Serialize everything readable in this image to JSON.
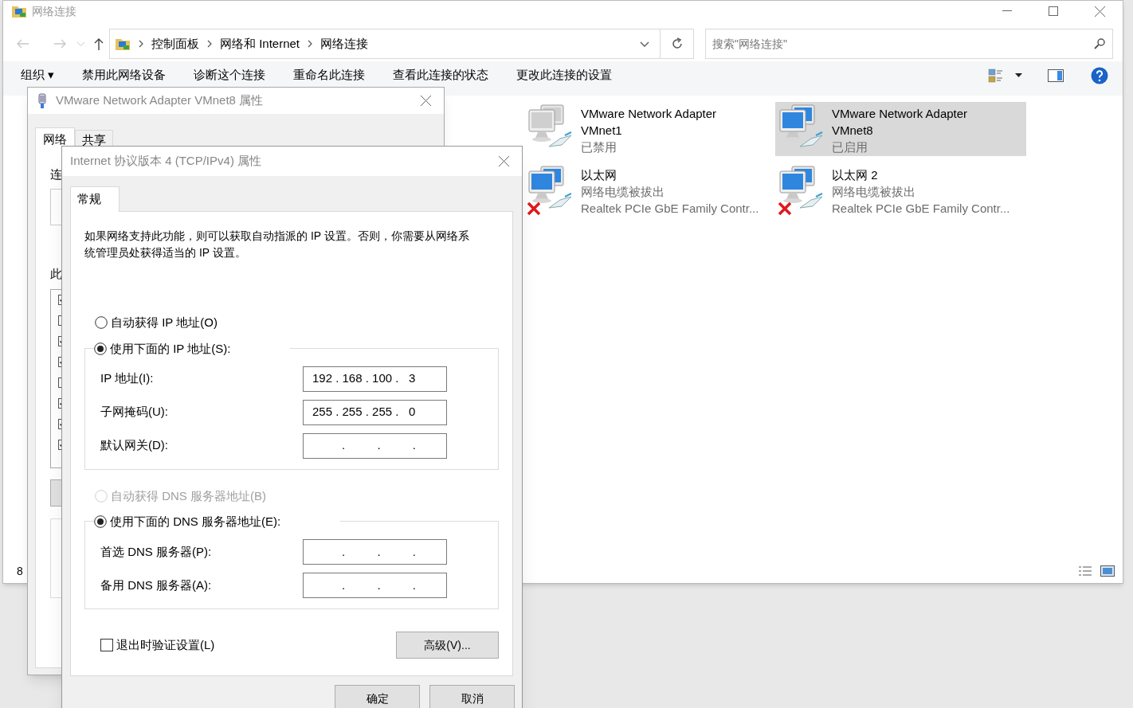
{
  "explorer": {
    "title": "网络连接",
    "breadcrumbs": [
      "控制面板",
      "网络和 Internet",
      "网络连接"
    ],
    "search": {
      "placeholder": "搜索\"网络连接\""
    },
    "toolbar": [
      "组织 ▾",
      "禁用此网络设备",
      "诊断这个连接",
      "重命名此连接",
      "查看此连接的状态",
      "更改此连接的设置"
    ],
    "adapters": [
      {
        "name": "VMware Network Adapter VMnet1",
        "status": "已禁用",
        "disabled": true,
        "unplugged": false,
        "selected": false
      },
      {
        "name": "VMware Network Adapter VMnet8",
        "status": "已启用",
        "disabled": false,
        "unplugged": false,
        "selected": true
      },
      {
        "name": "以太网",
        "status": "网络电缆被拔出",
        "device": "Realtek PCIe GbE Family Contr...",
        "disabled": false,
        "unplugged": true,
        "selected": false
      },
      {
        "name": "以太网 2",
        "status": "网络电缆被拔出",
        "device": "Realtek PCIe GbE Family Contr...",
        "disabled": false,
        "unplugged": true,
        "selected": false
      }
    ],
    "status_bar": "8"
  },
  "adapter_dialog": {
    "title": "VMware Network Adapter VMnet8 属性",
    "tabs": [
      {
        "label": "网络",
        "selected": true
      },
      {
        "label": "共享",
        "selected": false
      }
    ],
    "fragments": [
      "连",
      "此"
    ],
    "list_items": [
      {
        "checked": true
      },
      {
        "checked": false
      },
      {
        "checked": true
      },
      {
        "checked": true
      },
      {
        "checked": false
      },
      {
        "checked": true
      },
      {
        "checked": true
      },
      {
        "checked": true
      }
    ]
  },
  "ipv4_dialog": {
    "title": "Internet 协议版本 4 (TCP/IPv4) 属性",
    "tabs": [
      {
        "label": "常规",
        "selected": true
      }
    ],
    "description": "如果网络支持此功能，则可以获取自动指派的 IP 设置。否则，你需要从网络系统管理员处获得适当的 IP 设置。",
    "ip_options": [
      {
        "label": "自动获得 IP 地址(O)",
        "selected": false,
        "disabled": false
      },
      {
        "label": "使用下面的 IP 地址(S):",
        "selected": true,
        "disabled": false
      }
    ],
    "ip_fields": [
      {
        "label": "IP 地址(I):",
        "kind": "set",
        "value": "192 . 168 . 100 .   3"
      },
      {
        "label": "子网掩码(U):",
        "kind": "set",
        "value": "255 . 255 . 255 .   0"
      },
      {
        "label": "默认网关(D):",
        "kind": "blank",
        "value": ". . ."
      }
    ],
    "dns_options": [
      {
        "label": "自动获得 DNS 服务器地址(B)",
        "selected": false,
        "disabled": true
      },
      {
        "label": "使用下面的 DNS 服务器地址(E):",
        "selected": true,
        "disabled": false
      }
    ],
    "dns_fields": [
      {
        "label": "首选 DNS 服务器(P):",
        "kind": "blank",
        "value": ". . ."
      },
      {
        "label": "备用 DNS 服务器(A):",
        "kind": "blank",
        "value": ". . ."
      }
    ],
    "validate": {
      "label": "退出时验证设置(L)",
      "checked": false
    },
    "advanced_button": "高级(V)...",
    "buttons": [
      "确定",
      "取消"
    ]
  }
}
